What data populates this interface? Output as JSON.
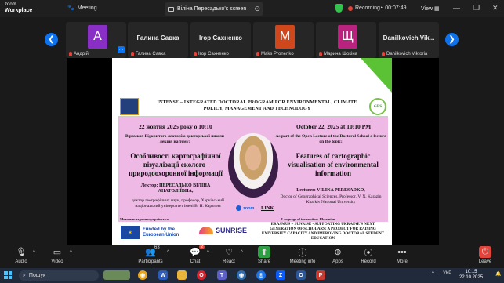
{
  "app": {
    "logo_line1": "zoom",
    "logo_line2": "Workplace",
    "meeting_label": "Meeting",
    "share_tab_label": "Віліна Пересадько's screen",
    "recording_label": "Recording",
    "timer": "00:07:49",
    "view_label": "View"
  },
  "participants": [
    {
      "name": "Андрій",
      "initial": "А",
      "color": "#8a2fc6"
    },
    {
      "name": "Галина Савка",
      "display": "Галина Савка"
    },
    {
      "name": "Ігор Сахненко",
      "display": "Ігор Сахненко"
    },
    {
      "name": "Maks Pronenko",
      "initial": "M",
      "color": "#d0471c"
    },
    {
      "name": "Марина Щокіна",
      "initial": "Щ",
      "color": "#b8247d"
    },
    {
      "name": "Danilkovich Viktoria",
      "display": "Danilkovich Vik..."
    }
  ],
  "poster": {
    "header": "INTENSE – INTEGRATED DOCTORAL PROGRAM FOR ENVIRONMENTAL, CLIMATE POLICY, MANAGEMENT AND TECHNOLOGY",
    "ges_logo": "GES",
    "date_ua": "22 жовтня 2025 року о 10:10",
    "date_en": "October 22, 2025 at 10:10 PM",
    "subtitle_ua": "В рамках Відкритого лекторію докторської школи лекція на тему:",
    "subtitle_en": "As part of the Open Lecture of the Doctoral School a lecture on the topic:",
    "title_ua": "Особливості картографічної візуалізації еколого-природоохоронної інформації",
    "title_en": "Features of cartographic visualisation of environmental information",
    "lecturer_ua": "Лектор: ПЕРЕСАДЬКО ВІЛІНА АНАТОЛІЇВНА,",
    "lecturer_ua_details": "доктор географічних наук, професор, Харківський національний університет імені В. Н. Каразіна",
    "lecturer_en": "Lecturer: VILINA PERESADKO,",
    "lecturer_en_details": "Doctor of Geographical Sciences, Professor, V. N. Karazin Kharkiv National University",
    "zoom_label": "zoom",
    "link_label": "LINK",
    "language_ua": "Мова викладання: українська",
    "language_en": "Language of instruction: Ukrainian",
    "eu_text": "Funded by the European Union",
    "sunrise_text": "SUNRISE",
    "erasmus_text": "ERASMUS + SUNRISE - SUPPORTING UKRAINE'S NEXT GENERATION OF SCHOLARS: A PROJECT FOR RAISING UNIVERSITY CAPACITY AND IMPROVING DOCTORAL STUDENT EDUCATION"
  },
  "toolbar": {
    "audio": "Audio",
    "video": "Video",
    "participants": "Participants",
    "participants_count": "63",
    "chat": "Chat",
    "chat_badge": "2",
    "react": "React",
    "share": "Share",
    "meeting_info": "Meeting info",
    "apps": "Apps",
    "record": "Record",
    "more": "More",
    "leave": "Leave"
  },
  "taskbar": {
    "search_placeholder": "Пошук",
    "lang": "УКР",
    "time": "10:15",
    "date": "22.10.2025"
  }
}
